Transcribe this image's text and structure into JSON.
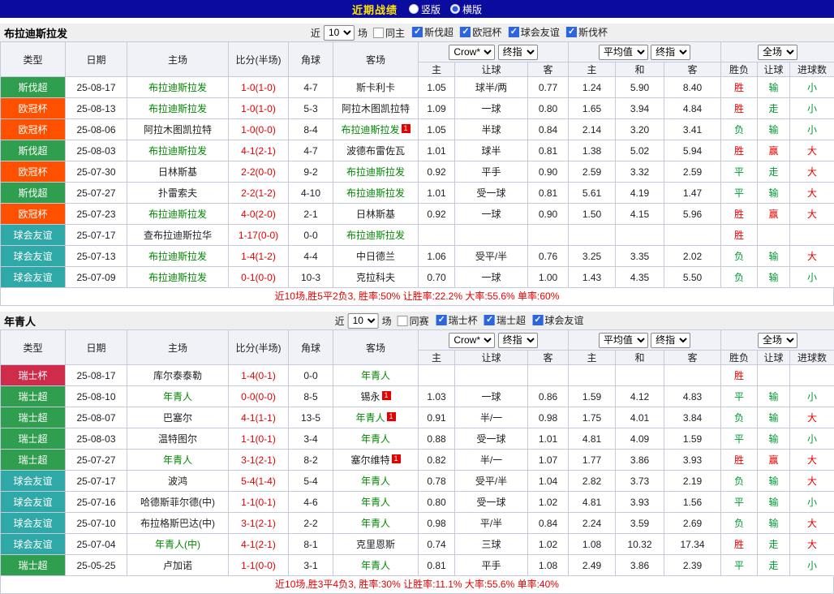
{
  "topbar": {
    "title": "近期战绩",
    "vertical_label": "竖版",
    "horizontal_label": "横版",
    "vertical_checked": false,
    "horizontal_checked": true
  },
  "ui": {
    "near_label": "近",
    "games_label": "场",
    "rc_label": "1"
  },
  "colors": {
    "league": {
      "斯伐超": "#2f9e4f",
      "欧冠杯": "#ff5000",
      "球会友谊": "#2fa8a8",
      "瑞士杯": "#cf2b4b",
      "瑞士超": "#2f9e4f"
    },
    "mark": {
      "胜": "#e60000",
      "平": "#009933",
      "负": "#009933",
      "赢": "#e60000",
      "输": "#009933",
      "走": "#009933",
      "大": "#e60000",
      "小": "#009933"
    },
    "focus_team": "#008800",
    "score": "#e60000"
  },
  "table_header": {
    "col_type": "类型",
    "col_date": "日期",
    "col_home": "主场",
    "col_score": "比分(半场)",
    "col_corner": "角球",
    "col_away": "客场",
    "grp1_sel1": "Crow*",
    "grp1_sel2": "终指",
    "grp2_sel1": "平均值",
    "grp2_sel2": "终指",
    "grp3_sel1": "全场",
    "sub": [
      "主",
      "让球",
      "客",
      "主",
      "和",
      "客",
      "胜负",
      "让球",
      "进球数"
    ]
  },
  "sections": [
    {
      "team": "布拉迪斯拉发",
      "filters": {
        "count": "10",
        "same_label": "同主",
        "same_checked": false,
        "leagues": [
          {
            "label": "斯伐超",
            "checked": true
          },
          {
            "label": "欧冠杯",
            "checked": true
          },
          {
            "label": "球会友谊",
            "checked": true
          },
          {
            "label": "斯伐杯",
            "checked": true
          }
        ]
      },
      "rows": [
        {
          "league": "斯伐超",
          "date": "25-08-17",
          "home": "布拉迪斯拉发",
          "home_rc": false,
          "score": "1-0(1-0)",
          "corner": "4-7",
          "away": "斯卡利卡",
          "away_rc": false,
          "o1": "1.05",
          "hcp": "球半/两",
          "o2": "0.77",
          "a1": "1.24",
          "a2": "5.90",
          "a3": "8.40",
          "r1": "胜",
          "r2": "输",
          "r3": "小"
        },
        {
          "league": "欧冠杯",
          "date": "25-08-13",
          "home": "布拉迪斯拉发",
          "home_rc": false,
          "score": "1-0(1-0)",
          "corner": "5-3",
          "away": "阿拉木图凯拉特",
          "away_rc": false,
          "o1": "1.09",
          "hcp": "一球",
          "o2": "0.80",
          "a1": "1.65",
          "a2": "3.94",
          "a3": "4.84",
          "r1": "胜",
          "r2": "走",
          "r3": "小"
        },
        {
          "league": "欧冠杯",
          "date": "25-08-06",
          "home": "阿拉木图凯拉特",
          "home_rc": false,
          "score": "1-0(0-0)",
          "corner": "8-4",
          "away": "布拉迪斯拉发",
          "away_rc": true,
          "o1": "1.05",
          "hcp": "半球",
          "o2": "0.84",
          "a1": "2.14",
          "a2": "3.20",
          "a3": "3.41",
          "r1": "负",
          "r2": "输",
          "r3": "小"
        },
        {
          "league": "斯伐超",
          "date": "25-08-03",
          "home": "布拉迪斯拉发",
          "home_rc": false,
          "score": "4-1(2-1)",
          "corner": "4-7",
          "away": "波德布雷佐瓦",
          "away_rc": false,
          "o1": "1.01",
          "hcp": "球半",
          "o2": "0.81",
          "a1": "1.38",
          "a2": "5.02",
          "a3": "5.94",
          "r1": "胜",
          "r2": "赢",
          "r3": "大"
        },
        {
          "league": "欧冠杯",
          "date": "25-07-30",
          "home": "日林斯基",
          "home_rc": false,
          "score": "2-2(0-0)",
          "corner": "9-2",
          "away": "布拉迪斯拉发",
          "away_rc": false,
          "o1": "0.92",
          "hcp": "平手",
          "o2": "0.90",
          "a1": "2.59",
          "a2": "3.32",
          "a3": "2.59",
          "r1": "平",
          "r2": "走",
          "r3": "大"
        },
        {
          "league": "斯伐超",
          "date": "25-07-27",
          "home": "扑雷索夫",
          "home_rc": false,
          "score": "2-2(1-2)",
          "corner": "4-10",
          "away": "布拉迪斯拉发",
          "away_rc": false,
          "o1": "1.01",
          "hcp": "受一球",
          "o2": "0.81",
          "a1": "5.61",
          "a2": "4.19",
          "a3": "1.47",
          "r1": "平",
          "r2": "输",
          "r3": "大"
        },
        {
          "league": "欧冠杯",
          "date": "25-07-23",
          "home": "布拉迪斯拉发",
          "home_rc": false,
          "score": "4-0(2-0)",
          "corner": "2-1",
          "away": "日林斯基",
          "away_rc": false,
          "o1": "0.92",
          "hcp": "一球",
          "o2": "0.90",
          "a1": "1.50",
          "a2": "4.15",
          "a3": "5.96",
          "r1": "胜",
          "r2": "赢",
          "r3": "大"
        },
        {
          "league": "球会友谊",
          "date": "25-07-17",
          "home": "查布拉迪斯拉华",
          "home_rc": false,
          "score": "1-17(0-0)",
          "corner": "0-0",
          "away": "布拉迪斯拉发",
          "away_rc": false,
          "o1": "",
          "hcp": "",
          "o2": "",
          "a1": "",
          "a2": "",
          "a3": "",
          "r1": "胜",
          "r2": "",
          "r3": ""
        },
        {
          "league": "球会友谊",
          "date": "25-07-13",
          "home": "布拉迪斯拉发",
          "home_rc": false,
          "score": "1-4(1-2)",
          "corner": "4-4",
          "away": "中日德兰",
          "away_rc": false,
          "o1": "1.06",
          "hcp": "受平/半",
          "o2": "0.76",
          "a1": "3.25",
          "a2": "3.35",
          "a3": "2.02",
          "r1": "负",
          "r2": "输",
          "r3": "大"
        },
        {
          "league": "球会友谊",
          "date": "25-07-09",
          "home": "布拉迪斯拉发",
          "home_rc": false,
          "score": "0-1(0-0)",
          "corner": "10-3",
          "away": "克拉科夫",
          "away_rc": false,
          "o1": "0.70",
          "hcp": "一球",
          "o2": "1.00",
          "a1": "1.43",
          "a2": "4.35",
          "a3": "5.50",
          "r1": "负",
          "r2": "输",
          "r3": "小"
        }
      ],
      "summary": "近10场,胜5平2负3, 胜率:50% 让胜率:22.2% 大率:55.6% 单率:60%"
    },
    {
      "team": "年青人",
      "filters": {
        "count": "10",
        "same_label": "同赛",
        "same_checked": false,
        "leagues": [
          {
            "label": "瑞士杯",
            "checked": true
          },
          {
            "label": "瑞士超",
            "checked": true
          },
          {
            "label": "球会友谊",
            "checked": true
          }
        ]
      },
      "rows": [
        {
          "league": "瑞士杯",
          "date": "25-08-17",
          "home": "库尔泰泰勒",
          "home_rc": false,
          "score": "1-4(0-1)",
          "corner": "0-0",
          "away": "年青人",
          "away_rc": false,
          "o1": "",
          "hcp": "",
          "o2": "",
          "a1": "",
          "a2": "",
          "a3": "",
          "r1": "胜",
          "r2": "",
          "r3": ""
        },
        {
          "league": "瑞士超",
          "date": "25-08-10",
          "home": "年青人",
          "home_rc": false,
          "score": "0-0(0-0)",
          "corner": "8-5",
          "away": "锡永",
          "away_rc": true,
          "o1": "1.03",
          "hcp": "一球",
          "o2": "0.86",
          "a1": "1.59",
          "a2": "4.12",
          "a3": "4.83",
          "r1": "平",
          "r2": "输",
          "r3": "小"
        },
        {
          "league": "瑞士超",
          "date": "25-08-07",
          "home": "巴塞尔",
          "home_rc": false,
          "score": "4-1(1-1)",
          "corner": "13-5",
          "away": "年青人",
          "away_rc": true,
          "o1": "0.91",
          "hcp": "半/一",
          "o2": "0.98",
          "a1": "1.75",
          "a2": "4.01",
          "a3": "3.84",
          "r1": "负",
          "r2": "输",
          "r3": "大"
        },
        {
          "league": "瑞士超",
          "date": "25-08-03",
          "home": "温特图尔",
          "home_rc": false,
          "score": "1-1(0-1)",
          "corner": "3-4",
          "away": "年青人",
          "away_rc": false,
          "o1": "0.88",
          "hcp": "受一球",
          "o2": "1.01",
          "a1": "4.81",
          "a2": "4.09",
          "a3": "1.59",
          "r1": "平",
          "r2": "输",
          "r3": "小"
        },
        {
          "league": "瑞士超",
          "date": "25-07-27",
          "home": "年青人",
          "home_rc": false,
          "score": "3-1(2-1)",
          "corner": "8-2",
          "away": "塞尔维特",
          "away_rc": true,
          "o1": "0.82",
          "hcp": "半/一",
          "o2": "1.07",
          "a1": "1.77",
          "a2": "3.86",
          "a3": "3.93",
          "r1": "胜",
          "r2": "赢",
          "r3": "大"
        },
        {
          "league": "球会友谊",
          "date": "25-07-17",
          "home": "波鸿",
          "home_rc": false,
          "score": "5-4(1-4)",
          "corner": "5-4",
          "away": "年青人",
          "away_rc": false,
          "o1": "0.78",
          "hcp": "受平/半",
          "o2": "1.04",
          "a1": "2.82",
          "a2": "3.73",
          "a3": "2.19",
          "r1": "负",
          "r2": "输",
          "r3": "大"
        },
        {
          "league": "球会友谊",
          "date": "25-07-16",
          "home": "哈德斯菲尔德(中)",
          "home_rc": false,
          "score": "1-1(0-1)",
          "corner": "4-6",
          "away": "年青人",
          "away_rc": false,
          "o1": "0.80",
          "hcp": "受一球",
          "o2": "1.02",
          "a1": "4.81",
          "a2": "3.93",
          "a3": "1.56",
          "r1": "平",
          "r2": "输",
          "r3": "小"
        },
        {
          "league": "球会友谊",
          "date": "25-07-10",
          "home": "布拉格斯巴达(中)",
          "home_rc": false,
          "score": "3-1(2-1)",
          "corner": "2-2",
          "away": "年青人",
          "away_rc": false,
          "o1": "0.98",
          "hcp": "平/半",
          "o2": "0.84",
          "a1": "2.24",
          "a2": "3.59",
          "a3": "2.69",
          "r1": "负",
          "r2": "输",
          "r3": "大"
        },
        {
          "league": "球会友谊",
          "date": "25-07-04",
          "home": "年青人(中)",
          "home_rc": false,
          "score": "4-1(2-1)",
          "corner": "8-1",
          "away": "克里恩斯",
          "away_rc": false,
          "o1": "0.74",
          "hcp": "三球",
          "o2": "1.02",
          "a1": "1.08",
          "a2": "10.32",
          "a3": "17.34",
          "r1": "胜",
          "r2": "走",
          "r3": "大"
        },
        {
          "league": "瑞士超",
          "date": "25-05-25",
          "home": "卢加诺",
          "home_rc": false,
          "score": "1-1(0-0)",
          "corner": "3-1",
          "away": "年青人",
          "away_rc": false,
          "o1": "0.81",
          "hcp": "平手",
          "o2": "1.08",
          "a1": "2.49",
          "a2": "3.86",
          "a3": "2.39",
          "r1": "平",
          "r2": "走",
          "r3": "小"
        }
      ],
      "summary": "近10场,胜3平4负3, 胜率:30% 让胜率:11.1% 大率:55.6% 单率:40%"
    }
  ]
}
